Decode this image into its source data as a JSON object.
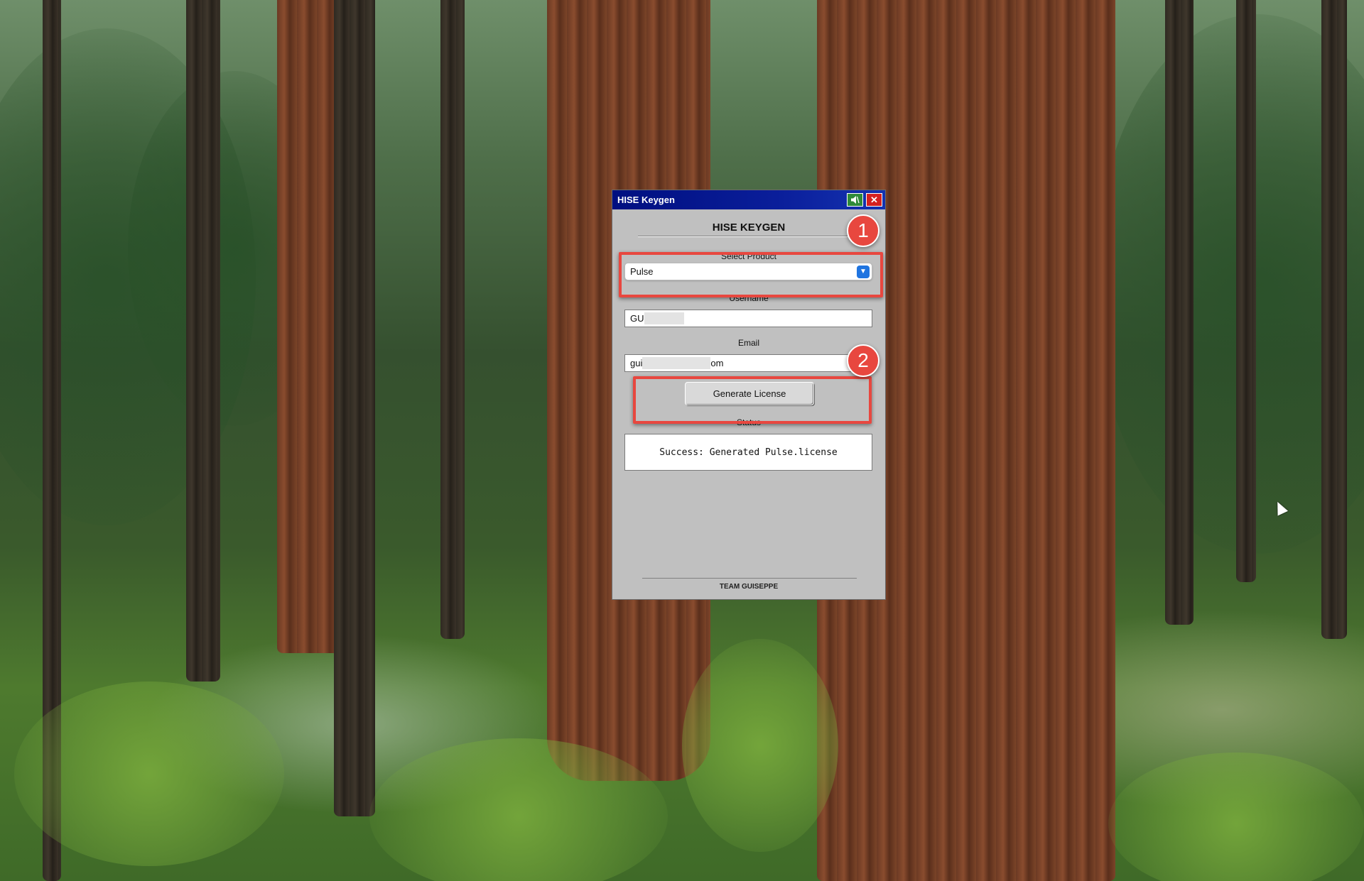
{
  "window": {
    "title": "HISE Keygen",
    "music_icon": "speaker-icon",
    "close_icon": "close-icon",
    "close_glyph": "✕"
  },
  "app": {
    "header": "HISE KEYGEN",
    "product_label": "Select Product",
    "product_value": "Pulse",
    "username_label": "Username",
    "username_value": "GU",
    "email_label": "Email",
    "email_prefix": "gui",
    "email_suffix": "om",
    "generate_button": "Generate License",
    "status_label": "Status",
    "status_text": "Success: Generated Pulse.license",
    "footer": "TEAM GUISEPPE"
  },
  "annotations": {
    "badge_1": "1",
    "badge_2": "2",
    "accent_color": "#e8473f"
  },
  "colors": {
    "title_bar": "#000f80",
    "window_bg": "#c0c0c0",
    "select_accent": "#1f74e0"
  }
}
